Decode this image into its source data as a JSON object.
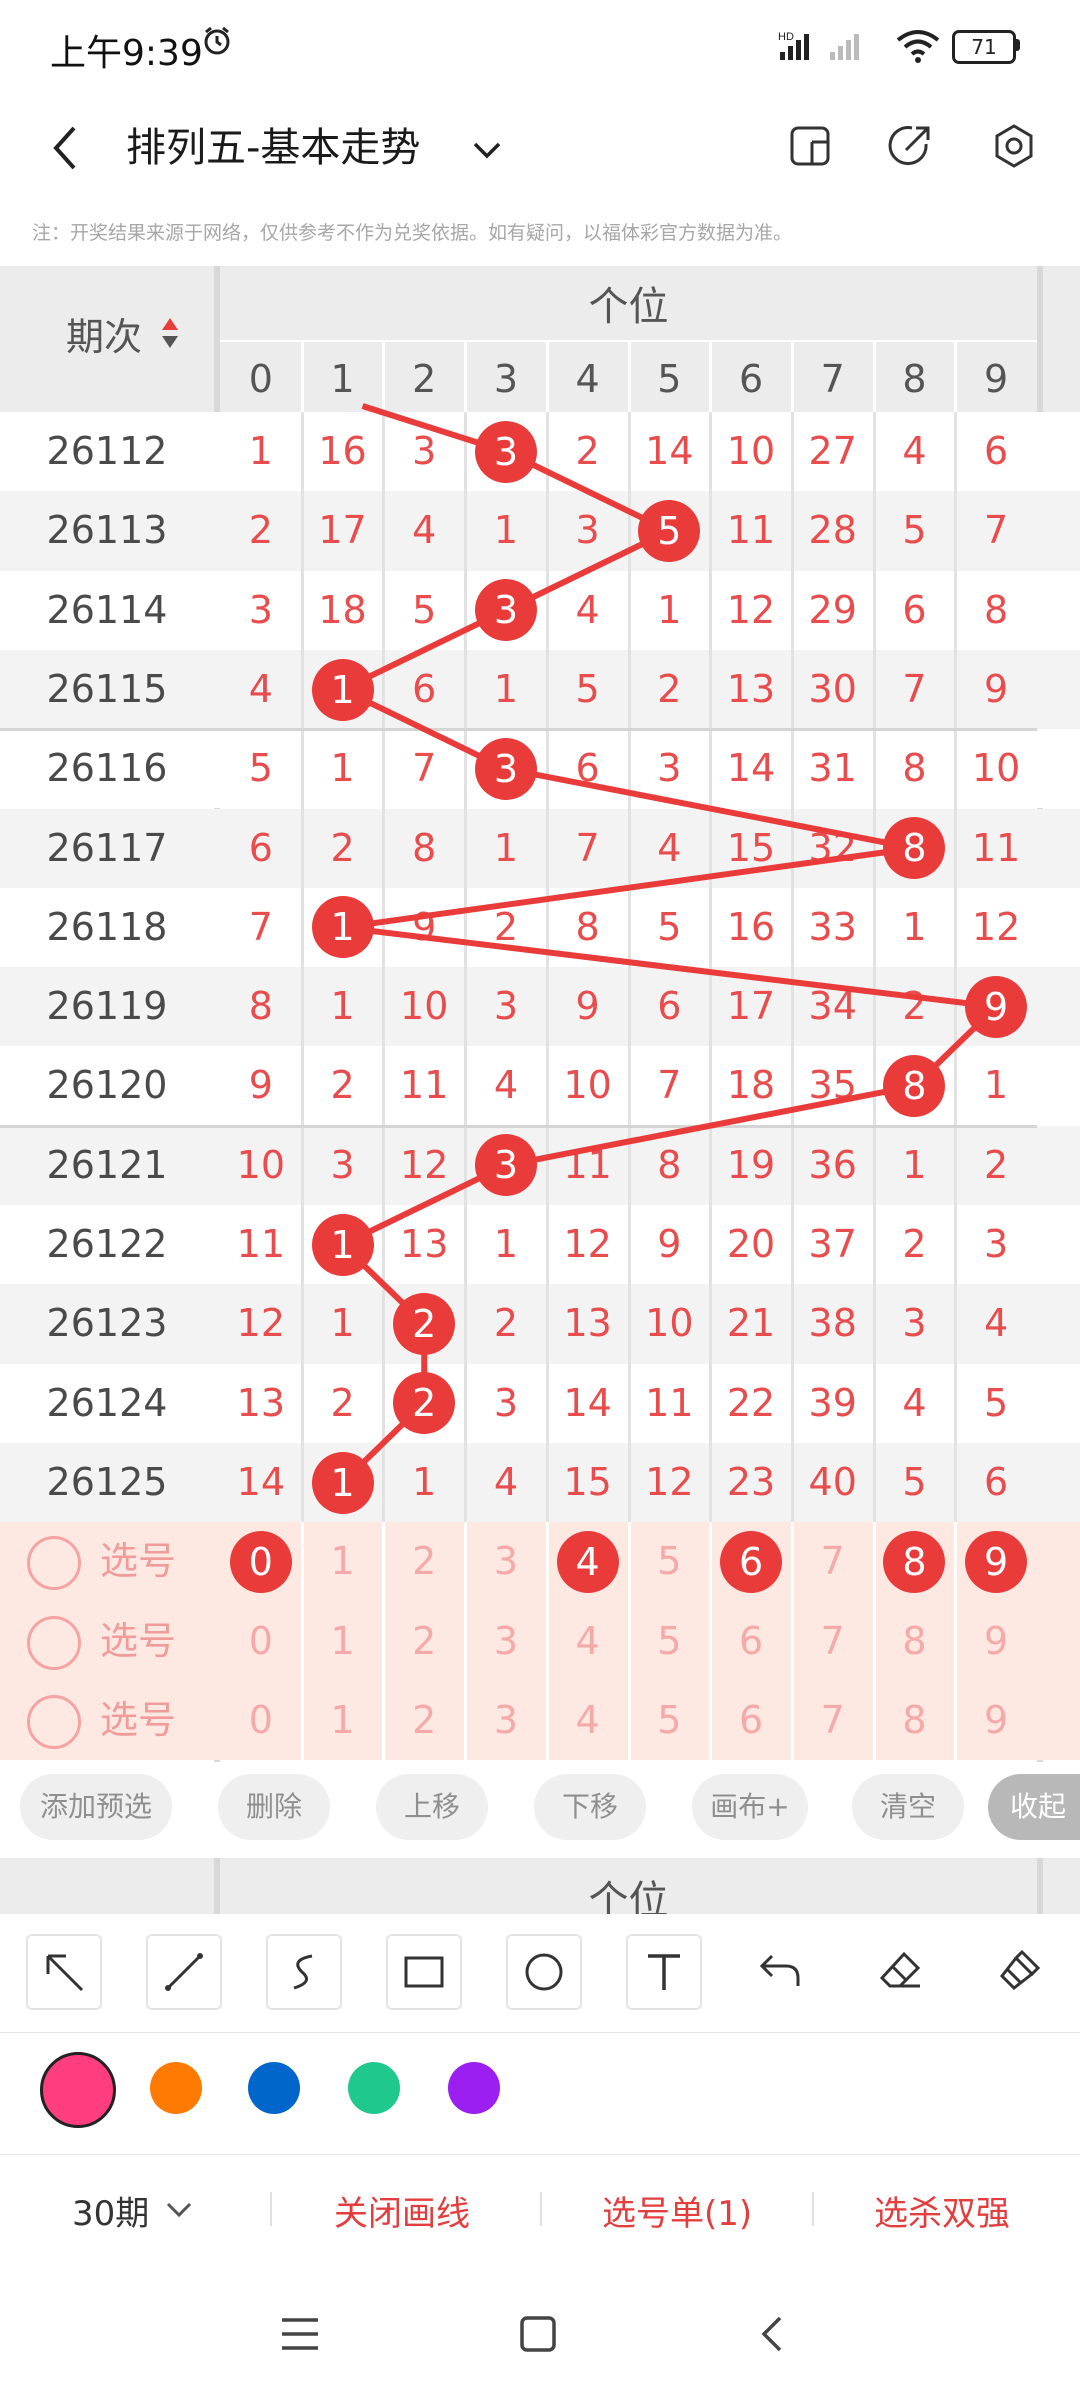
{
  "status_bar": {
    "time": "上午9:39",
    "battery": "71"
  },
  "header": {
    "title": "排列五-基本走势"
  },
  "notice": "注：开奖结果来源于网络，仅供参考不作为兑奖依据。如有疑问，以福体彩官方数据为准。",
  "table": {
    "period_header": "期次",
    "position_header": "个位",
    "digits": [
      "0",
      "1",
      "2",
      "3",
      "4",
      "5",
      "6",
      "7",
      "8",
      "9"
    ],
    "rows": [
      {
        "period": "26112",
        "winner": 3,
        "cells": [
          "1",
          "16",
          "3",
          "3",
          "2",
          "14",
          "10",
          "27",
          "4",
          "6"
        ]
      },
      {
        "period": "26113",
        "winner": 5,
        "cells": [
          "2",
          "17",
          "4",
          "1",
          "3",
          "5",
          "11",
          "28",
          "5",
          "7"
        ]
      },
      {
        "period": "26114",
        "winner": 3,
        "cells": [
          "3",
          "18",
          "5",
          "3",
          "4",
          "1",
          "12",
          "29",
          "6",
          "8"
        ]
      },
      {
        "period": "26115",
        "winner": 1,
        "cells": [
          "4",
          "1",
          "6",
          "1",
          "5",
          "2",
          "13",
          "30",
          "7",
          "9"
        ]
      },
      {
        "period": "26116",
        "winner": 3,
        "cells": [
          "5",
          "1",
          "7",
          "3",
          "6",
          "3",
          "14",
          "31",
          "8",
          "10"
        ]
      },
      {
        "period": "26117",
        "winner": 8,
        "cells": [
          "6",
          "2",
          "8",
          "1",
          "7",
          "4",
          "15",
          "32",
          "8",
          "11"
        ]
      },
      {
        "period": "26118",
        "winner": 1,
        "cells": [
          "7",
          "1",
          "9",
          "2",
          "8",
          "5",
          "16",
          "33",
          "1",
          "12"
        ]
      },
      {
        "period": "26119",
        "winner": 9,
        "cells": [
          "8",
          "1",
          "10",
          "3",
          "9",
          "6",
          "17",
          "34",
          "2",
          "9"
        ]
      },
      {
        "period": "26120",
        "winner": 8,
        "cells": [
          "9",
          "2",
          "11",
          "4",
          "10",
          "7",
          "18",
          "35",
          "8",
          "1"
        ]
      },
      {
        "period": "26121",
        "winner": 3,
        "cells": [
          "10",
          "3",
          "12",
          "3",
          "11",
          "8",
          "19",
          "36",
          "1",
          "2"
        ]
      },
      {
        "period": "26122",
        "winner": 1,
        "cells": [
          "11",
          "1",
          "13",
          "1",
          "12",
          "9",
          "20",
          "37",
          "2",
          "3"
        ]
      },
      {
        "period": "26123",
        "winner": 2,
        "cells": [
          "12",
          "1",
          "2",
          "2",
          "13",
          "10",
          "21",
          "38",
          "3",
          "4"
        ]
      },
      {
        "period": "26124",
        "winner": 2,
        "cells": [
          "13",
          "2",
          "2",
          "3",
          "14",
          "11",
          "22",
          "39",
          "4",
          "5"
        ]
      },
      {
        "period": "26125",
        "winner": 1,
        "cells": [
          "14",
          "1",
          "1",
          "4",
          "15",
          "12",
          "23",
          "40",
          "5",
          "6"
        ]
      }
    ],
    "select_label": "选号",
    "select_rows": [
      {
        "selected": [
          0,
          4,
          6,
          8,
          9
        ]
      },
      {
        "selected": []
      },
      {
        "selected": []
      }
    ]
  },
  "actions": {
    "add_preselect": "添加预选",
    "delete": "删除",
    "move_up": "上移",
    "move_down": "下移",
    "canvas_plus": "画布+",
    "clear": "清空",
    "collapse": "收起"
  },
  "lower_header": "个位",
  "tools": [
    "arrow-tool-icon",
    "line-tool-icon",
    "freehand-tool-icon",
    "rectangle-tool-icon",
    "circle-tool-icon",
    "text-tool-icon",
    "undo-icon",
    "eraser-icon",
    "clear-brush-icon"
  ],
  "colors": {
    "accent": "#ea3b3b",
    "swatches": [
      "#ff3d7f",
      "#ff7a00",
      "#0066cc",
      "#1fc98e",
      "#9b1ff0"
    ]
  },
  "bottom_bar": {
    "periods": "30期",
    "close_lines": "关闭画线",
    "pick_list": "选号单(1)",
    "kill_double": "选杀双强"
  }
}
